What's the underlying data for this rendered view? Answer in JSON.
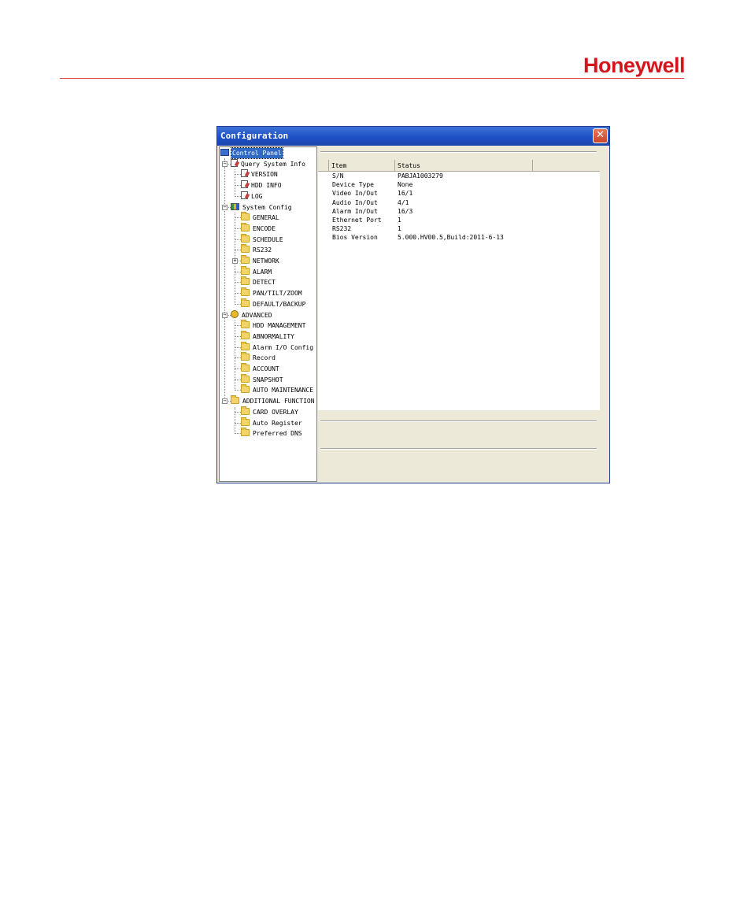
{
  "brand": {
    "logo_text": "Honeywell",
    "color": "#d4161c"
  },
  "window": {
    "title": "Configuration",
    "close_glyph": "✕"
  },
  "tree": [
    {
      "id": "control-panel",
      "label": "Control Panel",
      "icon": "monitor-icon",
      "level": 0,
      "selected": true
    },
    {
      "id": "query-system-info",
      "label": "Query System Info",
      "icon": "doc-edit-icon",
      "level": 1,
      "expander": "−"
    },
    {
      "id": "version",
      "label": "VERSION",
      "icon": "doc-edit-icon",
      "level": 2
    },
    {
      "id": "hdd-info",
      "label": "HDD INFO",
      "icon": "doc-edit-icon",
      "level": 2
    },
    {
      "id": "log",
      "label": "LOG",
      "icon": "doc-edit-icon",
      "level": 2
    },
    {
      "id": "system-config",
      "label": "System Config",
      "icon": "config-icon",
      "level": 1,
      "expander": "−"
    },
    {
      "id": "general",
      "label": "GENERAL",
      "icon": "folder-icon",
      "level": 2
    },
    {
      "id": "encode",
      "label": "ENCODE",
      "icon": "folder-icon",
      "level": 2
    },
    {
      "id": "schedule",
      "label": "SCHEDULE",
      "icon": "folder-icon",
      "level": 2
    },
    {
      "id": "rs232",
      "label": "RS232",
      "icon": "folder-icon",
      "level": 2
    },
    {
      "id": "network",
      "label": "NETWORK",
      "icon": "folder-icon",
      "level": 2,
      "expander": "+"
    },
    {
      "id": "alarm",
      "label": "ALARM",
      "icon": "folder-icon",
      "level": 2
    },
    {
      "id": "detect",
      "label": "DETECT",
      "icon": "folder-icon",
      "level": 2
    },
    {
      "id": "pan-tilt-zoom",
      "label": "PAN/TILT/ZOOM",
      "icon": "folder-icon",
      "level": 2
    },
    {
      "id": "default-backup",
      "label": "DEFAULT/BACKUP",
      "icon": "folder-icon",
      "level": 2
    },
    {
      "id": "advanced",
      "label": "ADVANCED",
      "icon": "gear-icon",
      "level": 1,
      "expander": "−"
    },
    {
      "id": "hdd-management",
      "label": "HDD MANAGEMENT",
      "icon": "folder-icon",
      "level": 2
    },
    {
      "id": "abnormality",
      "label": "ABNORMALITY",
      "icon": "folder-icon",
      "level": 2
    },
    {
      "id": "alarm-io-config",
      "label": "Alarm I/O Config",
      "icon": "folder-icon",
      "level": 2
    },
    {
      "id": "record",
      "label": "Record",
      "icon": "folder-icon",
      "level": 2
    },
    {
      "id": "account",
      "label": "ACCOUNT",
      "icon": "folder-icon",
      "level": 2
    },
    {
      "id": "snapshot",
      "label": "SNAPSHOT",
      "icon": "folder-icon",
      "level": 2
    },
    {
      "id": "auto-maintenance",
      "label": "AUTO MAINTENANCE",
      "icon": "folder-icon",
      "level": 2
    },
    {
      "id": "additional-function",
      "label": "ADDITIONAL FUNCTION",
      "icon": "folder-icon",
      "level": 1,
      "expander": "−"
    },
    {
      "id": "card-overlay",
      "label": "CARD OVERLAY",
      "icon": "folder-icon",
      "level": 2
    },
    {
      "id": "auto-register",
      "label": "Auto Register",
      "icon": "folder-icon",
      "level": 2
    },
    {
      "id": "preferred-dns",
      "label": "Preferred DNS",
      "icon": "folder-icon",
      "level": 2
    }
  ],
  "table": {
    "columns": [
      "Item",
      "Status"
    ],
    "rows": [
      [
        "S/N",
        "PABJA1003279"
      ],
      [
        "Device Type",
        "None"
      ],
      [
        "Video In/Out",
        "16/1"
      ],
      [
        "Audio In/Out",
        "4/1"
      ],
      [
        "Alarm In/Out",
        "16/3"
      ],
      [
        "Ethernet Port",
        "1"
      ],
      [
        "RS232",
        "1"
      ],
      [
        "Bios Version",
        "5.000.HV00.5,Build:2011-6-13"
      ]
    ]
  }
}
